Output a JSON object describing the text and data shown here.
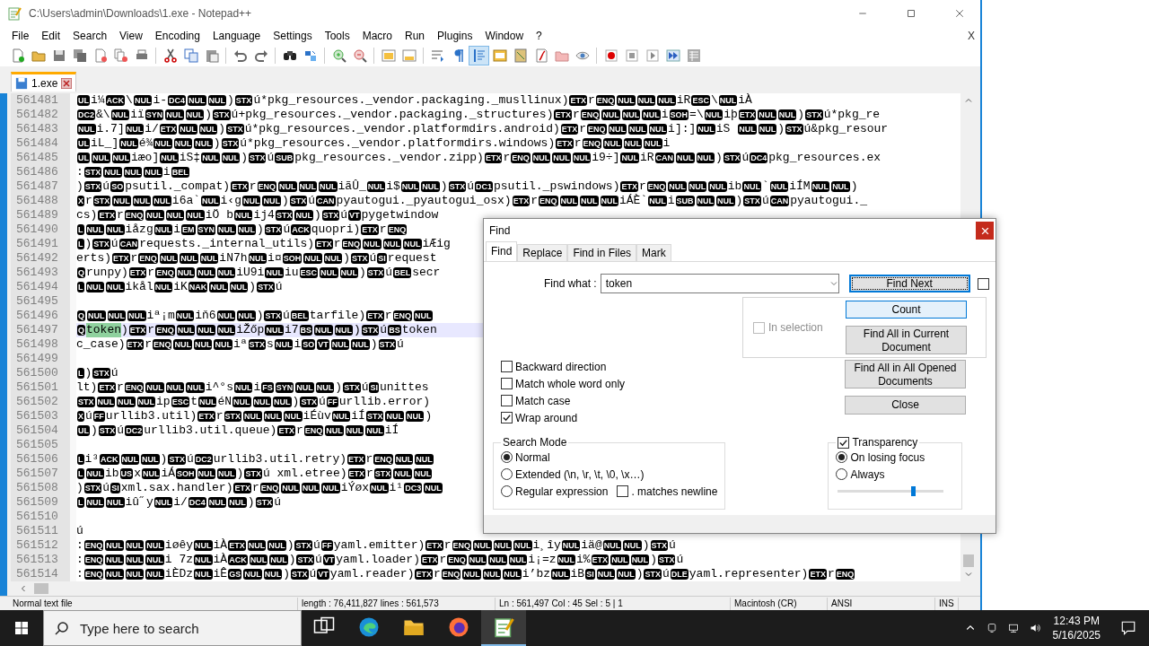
{
  "window": {
    "title": "C:\\Users\\admin\\Downloads\\1.exe - Notepad++"
  },
  "menu": [
    "File",
    "Edit",
    "Search",
    "View",
    "Encoding",
    "Language",
    "Settings",
    "Tools",
    "Macro",
    "Run",
    "Plugins",
    "Window",
    "?"
  ],
  "menu_close": "X",
  "toolbar": [
    [
      {
        "kind": "new",
        "pressed": false
      },
      {
        "kind": "open",
        "pressed": false
      },
      {
        "kind": "save",
        "pressed": false
      },
      {
        "kind": "saveall",
        "pressed": false
      },
      {
        "kind": "close",
        "pressed": false
      },
      {
        "kind": "closeall",
        "pressed": false
      },
      {
        "kind": "print",
        "pressed": false
      }
    ],
    [
      {
        "kind": "cut",
        "pressed": false
      },
      {
        "kind": "copy",
        "pressed": false
      },
      {
        "kind": "paste",
        "pressed": false
      }
    ],
    [
      {
        "kind": "undo",
        "pressed": false
      },
      {
        "kind": "redo",
        "pressed": false
      }
    ],
    [
      {
        "kind": "find",
        "pressed": false
      },
      {
        "kind": "replace",
        "pressed": false
      }
    ],
    [
      {
        "kind": "zoomin",
        "pressed": false
      },
      {
        "kind": "zoomout",
        "pressed": false
      }
    ],
    [
      {
        "kind": "syncv",
        "pressed": false
      },
      {
        "kind": "synch",
        "pressed": false
      }
    ],
    [
      {
        "kind": "wrap",
        "pressed": false
      },
      {
        "kind": "allchars",
        "pressed": false
      },
      {
        "kind": "indent",
        "pressed": true
      },
      {
        "kind": "udl",
        "pressed": false
      },
      {
        "kind": "docmap",
        "pressed": false
      },
      {
        "kind": "funclist",
        "pressed": false
      },
      {
        "kind": "folder",
        "pressed": false
      },
      {
        "kind": "monitor",
        "pressed": false
      }
    ],
    [
      {
        "kind": "record",
        "pressed": false
      },
      {
        "kind": "stop",
        "pressed": false
      },
      {
        "kind": "play",
        "pressed": false
      },
      {
        "kind": "playmulti",
        "pressed": false
      },
      {
        "kind": "savemacro",
        "pressed": false
      }
    ]
  ],
  "tabs": [
    {
      "label": "1.exe",
      "selected": true
    }
  ],
  "editor": {
    "lines": [
      {
        "number": "561481",
        "current": false,
        "segments": [
          [
            "UL"
          ],
          "i¼",
          [
            "ACK"
          ],
          "\\",
          [
            "NUL"
          ],
          "i-",
          [
            "DC4"
          ],
          [
            "NUL"
          ],
          [
            "NUL"
          ],
          ")",
          [
            "STX"
          ],
          "ú*pkg_resources._vendor.packaging._musllinux)",
          [
            "ETX"
          ],
          "r",
          [
            "ENQ"
          ],
          [
            "NUL"
          ],
          [
            "NUL"
          ],
          [
            "NUL"
          ],
          "iR",
          [
            "ESC"
          ],
          "\\",
          [
            "NUL"
          ],
          "iÀ"
        ]
      },
      {
        "number": "561482",
        "current": false,
        "segments": [
          [
            "DC2"
          ],
          "&\\",
          [
            "NUL"
          ],
          "iï",
          [
            "SYN"
          ],
          [
            "NUL"
          ],
          [
            "NUL"
          ],
          ")",
          [
            "STX"
          ],
          "ú+pkg_resources._vendor.packaging._structures)",
          [
            "ETX"
          ],
          "r",
          [
            "ENQ"
          ],
          [
            "NUL"
          ],
          [
            "NUL"
          ],
          [
            "NUL"
          ],
          "i",
          [
            "SOH"
          ],
          "=\\",
          [
            "NUL"
          ],
          "iþ",
          [
            "ETX"
          ],
          [
            "NUL"
          ],
          [
            "NUL"
          ],
          ")",
          [
            "STX"
          ],
          "ú*pkg_re"
        ]
      },
      {
        "number": "561483",
        "current": false,
        "segments": [
          [
            "NUL"
          ],
          "i.7]",
          [
            "NUL"
          ],
          "i/",
          [
            "ETX"
          ],
          [
            "NUL"
          ],
          [
            "NUL"
          ],
          ")",
          [
            "STX"
          ],
          "ú*pkg_resources._vendor.platformdirs.android)",
          [
            "ETX"
          ],
          "r",
          [
            "ENQ"
          ],
          [
            "NUL"
          ],
          [
            "NUL"
          ],
          [
            "NUL"
          ],
          "i]:]",
          [
            "NUL"
          ],
          "iS ",
          [
            "NUL"
          ],
          [
            "NUL"
          ],
          ")",
          [
            "STX"
          ],
          "ú&pkg_resour"
        ]
      },
      {
        "number": "561484",
        "current": false,
        "segments": [
          [
            "UL"
          ],
          "iL_]",
          [
            "NUL"
          ],
          "é¾",
          [
            "NUL"
          ],
          [
            "NUL"
          ],
          [
            "NUL"
          ],
          ")",
          [
            "STX"
          ],
          "ú*pkg_resources._vendor.platformdirs.windows)",
          [
            "ETX"
          ],
          "r",
          [
            "ENQ"
          ],
          [
            "NUL"
          ],
          [
            "NUL"
          ],
          [
            "NUL"
          ],
          "i"
        ]
      },
      {
        "number": "561485",
        "current": false,
        "segments": [
          [
            "UL"
          ],
          [
            "NUL"
          ],
          [
            "NUL"
          ],
          "iæo]",
          [
            "NUL"
          ],
          "iS‡",
          [
            "NUL"
          ],
          [
            "NUL"
          ],
          ")",
          [
            "STX"
          ],
          "ú",
          [
            "SUB"
          ],
          "pkg_resources._vendor.zipp)",
          [
            "ETX"
          ],
          "r",
          [
            "ENQ"
          ],
          [
            "NUL"
          ],
          [
            "NUL"
          ],
          [
            "NUL"
          ],
          "i9÷]",
          [
            "NUL"
          ],
          "iR",
          [
            "CAN"
          ],
          [
            "NUL"
          ],
          [
            "NUL"
          ],
          ")",
          [
            "STX"
          ],
          "ú",
          [
            "DC4"
          ],
          "pkg_resources.ex"
        ]
      },
      {
        "number": "561486",
        "current": false,
        "segments": [
          ":",
          [
            "STX"
          ],
          [
            "NUL"
          ],
          [
            "NUL"
          ],
          [
            "NUL"
          ],
          "i",
          [
            "BEL"
          ]
        ]
      },
      {
        "number": "561487",
        "current": false,
        "segments": [
          ")",
          [
            "STX"
          ],
          "ú",
          [
            "SO"
          ],
          "psutil._compat)",
          [
            "ETX"
          ],
          "r",
          [
            "ENQ"
          ],
          [
            "NUL"
          ],
          [
            "NUL"
          ],
          [
            "NUL"
          ],
          "iãÛ_",
          [
            "NUL"
          ],
          "i$",
          [
            "NUL"
          ],
          [
            "NUL"
          ],
          ")",
          [
            "STX"
          ],
          "ú",
          [
            "DC1"
          ],
          "psutil._pswindows)",
          [
            "ETX"
          ],
          "r",
          [
            "ENQ"
          ],
          [
            "NUL"
          ],
          [
            "NUL"
          ],
          [
            "NUL"
          ],
          "ib",
          [
            "NUL"
          ],
          "`",
          [
            "NUL"
          ],
          "iÍM",
          [
            "NUL"
          ],
          [
            "NUL"
          ],
          ")"
        ]
      },
      {
        "number": "561488",
        "current": false,
        "segments": [
          [
            "X"
          ],
          "r",
          [
            "STX"
          ],
          [
            "NUL"
          ],
          [
            "NUL"
          ],
          [
            "NUL"
          ],
          "i6a`",
          [
            "NUL"
          ],
          "i‹g",
          [
            "NUL"
          ],
          [
            "NUL"
          ],
          ")",
          [
            "STX"
          ],
          "ú",
          [
            "CAN"
          ],
          "pyautogui._pyautogui_osx)",
          [
            "ETX"
          ],
          "r",
          [
            "ENQ"
          ],
          [
            "NUL"
          ],
          [
            "NUL"
          ],
          [
            "NUL"
          ],
          "iÁÈ`",
          [
            "NUL"
          ],
          "i",
          [
            "SUB"
          ],
          [
            "NUL"
          ],
          [
            "NUL"
          ],
          ")",
          [
            "STX"
          ],
          "ú",
          [
            "CAN"
          ],
          "pyautogui._"
        ]
      },
      {
        "number": "561489",
        "current": false,
        "segments": [
          "cs)",
          [
            "ETX"
          ],
          "r",
          [
            "ENQ"
          ],
          [
            "NUL"
          ],
          [
            "NUL"
          ],
          [
            "NUL"
          ],
          "iÖ b",
          [
            "NUL"
          ],
          "ij4",
          [
            "STX"
          ],
          [
            "NUL"
          ],
          ")",
          [
            "STX"
          ],
          "ú",
          [
            "VT"
          ],
          "pygetwindow"
        ]
      },
      {
        "number": "561490",
        "current": false,
        "segments": [
          [
            "L"
          ],
          [
            "NUL"
          ],
          [
            "NUL"
          ],
          "iåzg",
          [
            "NUL"
          ],
          "i",
          [
            "EM"
          ],
          [
            "SYN"
          ],
          [
            "NUL"
          ],
          [
            "NUL"
          ],
          ")",
          [
            "STX"
          ],
          "ú",
          [
            "ACK"
          ],
          "quopri)",
          [
            "ETX"
          ],
          "r",
          [
            "ENQ"
          ]
        ]
      },
      {
        "number": "561491",
        "current": false,
        "segments": [
          [
            "L"
          ],
          ")",
          [
            "STX"
          ],
          "ú",
          [
            "CAN"
          ],
          "requests._internal_utils)",
          [
            "ETX"
          ],
          "r",
          [
            "ENQ"
          ],
          [
            "NUL"
          ],
          [
            "NUL"
          ],
          [
            "NUL"
          ],
          "iÆig"
        ]
      },
      {
        "number": "561492",
        "current": false,
        "segments": [
          "erts)",
          [
            "ETX"
          ],
          "r",
          [
            "ENQ"
          ],
          [
            "NUL"
          ],
          [
            "NUL"
          ],
          [
            "NUL"
          ],
          "iN7h",
          [
            "NUL"
          ],
          "i¤",
          [
            "SOH"
          ],
          [
            "NUL"
          ],
          [
            "NUL"
          ],
          ")",
          [
            "STX"
          ],
          "ú",
          [
            "SI"
          ],
          "request"
        ]
      },
      {
        "number": "561493",
        "current": false,
        "segments": [
          [
            "Q"
          ],
          "runpy)",
          [
            "ETX"
          ],
          "r",
          [
            "ENQ"
          ],
          [
            "NUL"
          ],
          [
            "NUL"
          ],
          [
            "NUL"
          ],
          "iU9i",
          [
            "NUL"
          ],
          "iu",
          [
            "ESC"
          ],
          [
            "NUL"
          ],
          [
            "NUL"
          ],
          ")",
          [
            "STX"
          ],
          "ú",
          [
            "BEL"
          ],
          "secr"
        ]
      },
      {
        "number": "561494",
        "current": false,
        "segments": [
          [
            "L"
          ],
          [
            "NUL"
          ],
          [
            "NUL"
          ],
          "ikål",
          [
            "NUL"
          ],
          "iK",
          [
            "NAK"
          ],
          [
            "NUL"
          ],
          [
            "NUL"
          ],
          ")",
          [
            "STX"
          ],
          "ú"
        ]
      },
      {
        "number": "561495",
        "current": false
      },
      {
        "number": "561496",
        "current": false,
        "segments": [
          [
            "Q"
          ],
          [
            "NUL"
          ],
          [
            "NUL"
          ],
          [
            "NUL"
          ],
          "iª¡m",
          [
            "NUL"
          ],
          "iň6",
          [
            "NUL"
          ],
          [
            "NUL"
          ],
          ")",
          [
            "STX"
          ],
          "ú",
          [
            "BEL"
          ],
          "tarfile)",
          [
            "ETX"
          ],
          "r",
          [
            "ENQ"
          ],
          [
            "NUL"
          ]
        ]
      },
      {
        "number": "561497",
        "current": true,
        "segments": [
          [
            "Q"
          ],
          {
            "kind": "match",
            "text": "token"
          },
          ")",
          [
            "ETX"
          ],
          "r",
          [
            "ENQ"
          ],
          [
            "NUL"
          ],
          [
            "NUL"
          ],
          [
            "NUL"
          ],
          "iŽőp",
          [
            "NUL"
          ],
          "i7",
          [
            "BS"
          ],
          [
            "NUL"
          ],
          [
            "NUL"
          ],
          ")",
          [
            "STX"
          ],
          "ú",
          [
            "BS"
          ],
          "token"
        ]
      },
      {
        "number": "561498",
        "current": false,
        "segments": [
          "c_case)",
          [
            "ETX"
          ],
          "r",
          [
            "ENQ"
          ],
          [
            "NUL"
          ],
          [
            "NUL"
          ],
          [
            "NUL"
          ],
          "iª",
          [
            "STX"
          ],
          "s",
          [
            "NUL"
          ],
          "i",
          [
            "SO"
          ],
          [
            "VT"
          ],
          [
            "NUL"
          ],
          [
            "NUL"
          ],
          ")",
          [
            "STX"
          ],
          "ú"
        ]
      },
      {
        "number": "561499",
        "current": false
      },
      {
        "number": "561500",
        "current": false,
        "segments": [
          [
            "L"
          ],
          ")",
          [
            "STX"
          ],
          "ú"
        ]
      },
      {
        "number": "561501",
        "current": false,
        "segments": [
          "lt)",
          [
            "ETX"
          ],
          "r",
          [
            "ENQ"
          ],
          [
            "NUL"
          ],
          [
            "NUL"
          ],
          [
            "NUL"
          ],
          "i^°s",
          [
            "NUL"
          ],
          "i",
          [
            "FS"
          ],
          [
            "SYN"
          ],
          [
            "NUL"
          ],
          [
            "NUL"
          ],
          ")",
          [
            "STX"
          ],
          "ú",
          [
            "SI"
          ],
          "unittes"
        ]
      },
      {
        "number": "561502",
        "current": false,
        "segments": [
          [
            "STX"
          ],
          [
            "NUL"
          ],
          [
            "NUL"
          ],
          [
            "NUL"
          ],
          "ip",
          [
            "ESC"
          ],
          "t",
          [
            "NUL"
          ],
          "éN",
          [
            "NUL"
          ],
          [
            "NUL"
          ],
          [
            "NUL"
          ],
          ")",
          [
            "STX"
          ],
          "ú",
          [
            "FF"
          ],
          "urllib.error)"
        ]
      },
      {
        "number": "561503",
        "current": false,
        "segments": [
          [
            "X"
          ],
          "ú",
          [
            "FF"
          ],
          "urllib3.util)",
          [
            "ETX"
          ],
          "r",
          [
            "STX"
          ],
          [
            "NUL"
          ],
          [
            "NUL"
          ],
          [
            "NUL"
          ],
          "iÉùv",
          [
            "NUL"
          ],
          "iÍ",
          [
            "STX"
          ],
          [
            "NUL"
          ],
          [
            "NUL"
          ],
          ")"
        ]
      },
      {
        "number": "561504",
        "current": false,
        "segments": [
          [
            "UL"
          ],
          ")",
          [
            "STX"
          ],
          "ú",
          [
            "DC2"
          ],
          "urllib3.util.queue)",
          [
            "ETX"
          ],
          "r",
          [
            "ENQ"
          ],
          [
            "NUL"
          ],
          [
            "NUL"
          ],
          [
            "NUL"
          ],
          "iÍ"
        ]
      },
      {
        "number": "561505",
        "current": false
      },
      {
        "number": "561506",
        "current": false,
        "segments": [
          [
            "L"
          ],
          "i³",
          [
            "ACK"
          ],
          [
            "NUL"
          ],
          [
            "NUL"
          ],
          ")",
          [
            "STX"
          ],
          "ú",
          [
            "DC2"
          ],
          "urllib3.util.retry)",
          [
            "ETX"
          ],
          "r",
          [
            "ENQ"
          ],
          [
            "NUL"
          ],
          [
            "NUL"
          ]
        ]
      },
      {
        "number": "561507",
        "current": false,
        "segments": [
          [
            "L"
          ],
          [
            "NUL"
          ],
          "ib",
          [
            "US"
          ],
          "x",
          [
            "NUL"
          ],
          "iÁ",
          [
            "SOH"
          ],
          [
            "NUL"
          ],
          [
            "NUL"
          ],
          ")",
          [
            "STX"
          ],
          "ú xml.etree)",
          [
            "ETX"
          ],
          "r",
          [
            "STX"
          ],
          [
            "NUL"
          ],
          [
            "NUL"
          ]
        ]
      },
      {
        "number": "561508",
        "current": false,
        "segments": [
          ")",
          [
            "STX"
          ],
          "ú",
          [
            "SI"
          ],
          "xml.sax.handler)",
          [
            "ETX"
          ],
          "r",
          [
            "ENQ"
          ],
          [
            "NUL"
          ],
          [
            "NUL"
          ],
          [
            "NUL"
          ],
          "iÝøx",
          [
            "NUL"
          ],
          "i¹",
          [
            "DC3"
          ],
          [
            "NUL"
          ]
        ]
      },
      {
        "number": "561509",
        "current": false,
        "segments": [
          [
            "L"
          ],
          [
            "NUL"
          ],
          [
            "NUL"
          ],
          "iû˝y",
          [
            "NUL"
          ],
          "i/",
          [
            "DC4"
          ],
          [
            "NUL"
          ],
          [
            "NUL"
          ],
          ")",
          [
            "STX"
          ],
          "ú"
        ]
      },
      {
        "number": "561510",
        "current": false
      },
      {
        "number": "561511",
        "current": false,
        "segments": [
          "ú"
        ]
      },
      {
        "number": "561512",
        "current": false,
        "segments": [
          ":",
          [
            "ENQ"
          ],
          [
            "NUL"
          ],
          [
            "NUL"
          ],
          [
            "NUL"
          ],
          "iøêy",
          [
            "NUL"
          ],
          "iÀ",
          [
            "ETX"
          ],
          [
            "NUL"
          ],
          [
            "NUL"
          ],
          ")",
          [
            "STX"
          ],
          "ú",
          [
            "FF"
          ],
          "yaml.emitter)",
          [
            "ETX"
          ],
          "r",
          [
            "ENQ"
          ],
          [
            "NUL"
          ],
          [
            "NUL"
          ],
          [
            "NUL"
          ],
          "i¸îy",
          [
            "NUL"
          ],
          "iä@",
          [
            "NUL"
          ],
          [
            "NUL"
          ],
          ")",
          [
            "STX"
          ],
          "ú"
        ]
      },
      {
        "number": "561513",
        "current": false,
        "segments": [
          ":",
          [
            "ENQ"
          ],
          [
            "NUL"
          ],
          [
            "NUL"
          ],
          [
            "NUL"
          ],
          "i 7z",
          [
            "NUL"
          ],
          "iÀ",
          [
            "ACK"
          ],
          [
            "NUL"
          ],
          [
            "NUL"
          ],
          ")",
          [
            "STX"
          ],
          "ú",
          [
            "VT"
          ],
          "yaml.loader)",
          [
            "ETX"
          ],
          "r",
          [
            "ENQ"
          ],
          [
            "NUL"
          ],
          [
            "NUL"
          ],
          [
            "NUL"
          ],
          "i¡=z",
          [
            "NUL"
          ],
          "i%",
          [
            "ETX"
          ],
          [
            "NUL"
          ],
          [
            "NUL"
          ],
          ")",
          [
            "STX"
          ],
          "ú"
        ]
      },
      {
        "number": "561514",
        "current": false,
        "segments": [
          ":",
          [
            "ENQ"
          ],
          [
            "NUL"
          ],
          [
            "NUL"
          ],
          [
            "NUL"
          ],
          "iÈDz",
          [
            "NUL"
          ],
          "iÊ",
          [
            "GS"
          ],
          [
            "NUL"
          ],
          [
            "NUL"
          ],
          ")",
          [
            "STX"
          ],
          "ú",
          [
            "VT"
          ],
          "yaml.reader)",
          [
            "ETX"
          ],
          "r",
          [
            "ENQ"
          ],
          [
            "NUL"
          ],
          [
            "NUL"
          ],
          [
            "NUL"
          ],
          "i’bz",
          [
            "NUL"
          ],
          "iB",
          [
            "SI"
          ],
          [
            "NUL"
          ],
          [
            "NUL"
          ],
          ")",
          [
            "STX"
          ],
          "ú",
          [
            "DLE"
          ],
          "yaml.representer)",
          [
            "ETX"
          ],
          "r",
          [
            "ENQ"
          ]
        ]
      }
    ]
  },
  "status_bar": [
    "Normal text file",
    "length : 76,411,827    lines : 561,573",
    "Ln : 561,497    Col : 45    Sel : 5 | 1",
    "Macintosh (CR)",
    "ANSI",
    "INS"
  ],
  "find_dialog": {
    "title": "Find",
    "tabs": [
      {
        "label": "Find",
        "selected": true
      },
      {
        "label": "Replace",
        "selected": false
      },
      {
        "label": "Find in Files",
        "selected": false
      },
      {
        "label": "Mark",
        "selected": false
      }
    ],
    "find_what": {
      "label": "Find what :",
      "value": "token"
    },
    "find_next": {
      "label": "Find Next",
      "focused": true
    },
    "side_checkbox": {
      "checked": false
    },
    "in_selection": {
      "label": "In selection",
      "checked": false,
      "disabled": true
    },
    "panel_buttons": [
      {
        "label": "Count",
        "highlighted": true
      },
      {
        "label": "Find All in Current Document",
        "highlighted": false
      }
    ],
    "more_buttons": [
      {
        "label": "Find All in All Opened Documents",
        "highlighted": false
      },
      {
        "label": "Close",
        "highlighted": false
      }
    ],
    "options": [
      {
        "label": "Backward direction",
        "checked": false
      },
      {
        "label": "Match whole word only",
        "checked": false
      },
      {
        "label": "Match case",
        "checked": false
      },
      {
        "label": "Wrap around",
        "checked": true
      }
    ],
    "search_mode": {
      "title": "Search Mode",
      "options": [
        {
          "label": "Normal",
          "selected": true
        },
        {
          "label": "Extended (\\n, \\r, \\t, \\0, \\x…)",
          "selected": false
        },
        {
          "label": "Regular expression",
          "selected": false
        }
      ],
      "dot_newline": {
        "label": ". matches newline",
        "checked": false
      }
    },
    "transparency": {
      "label": "Transparency",
      "checked": true,
      "options": [
        {
          "label": "On losing focus",
          "selected": true
        },
        {
          "label": "Always",
          "selected": false
        }
      ],
      "level": 0.71
    }
  },
  "taskbar": {
    "search_placeholder": "Type here to search",
    "apps": [
      {
        "kind": "taskview",
        "selected": false
      },
      {
        "kind": "edge",
        "selected": false
      },
      {
        "kind": "explorer",
        "selected": false
      },
      {
        "kind": "firefox",
        "selected": false
      },
      {
        "kind": "notepad",
        "selected": true
      }
    ],
    "time": "12:43 PM",
    "date": "5/16/2025"
  }
}
